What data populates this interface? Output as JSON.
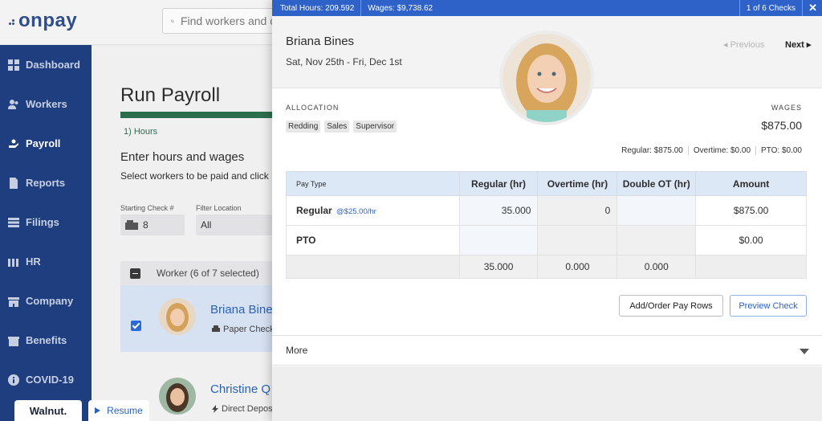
{
  "app": {
    "logo": "onpay"
  },
  "search": {
    "placeholder": "Find workers and co"
  },
  "sidebar": {
    "items": [
      {
        "label": "Dashboard",
        "icon": "dashboard-icon"
      },
      {
        "label": "Workers",
        "icon": "workers-icon"
      },
      {
        "label": "Payroll",
        "icon": "payroll-icon"
      },
      {
        "label": "Reports",
        "icon": "reports-icon"
      },
      {
        "label": "Filings",
        "icon": "filings-icon"
      },
      {
        "label": "HR",
        "icon": "hr-icon"
      },
      {
        "label": "Company",
        "icon": "company-icon"
      },
      {
        "label": "Benefits",
        "icon": "benefits-icon"
      },
      {
        "label": "COVID-19",
        "icon": "info-icon"
      }
    ]
  },
  "payroll_page": {
    "title": "Run Payroll",
    "step": "1) Hours",
    "heading": "Enter hours and wages",
    "subheading": "Select workers to be paid and click",
    "starting_check_label": "Starting Check #",
    "starting_check_value": "8",
    "filter_location_label": "Filter Location",
    "filter_location_value": "All",
    "worker_header": "Worker (6 of 7 selected)",
    "workers": [
      {
        "name": "Briana Bine",
        "method": "Paper Check"
      },
      {
        "name": "Christine Q",
        "method": "Direct Deposit"
      }
    ]
  },
  "walnut": {
    "label": "Walnut."
  },
  "resume": {
    "label": "Resume"
  },
  "panel": {
    "total_hours": "Total Hours: 209.592",
    "total_wages": "Wages: $9,738.62",
    "check_counter": "1 of 6 Checks",
    "close": "✕",
    "employee_name": "Briana Bines",
    "period": "Sat, Nov 25th - Fri, Dec 1st",
    "previous": "◂ Previous",
    "next": "Next ▸",
    "allocation_label": "ALLOCATION",
    "tags": [
      "Redding",
      "Sales",
      "Supervisor"
    ],
    "wages_label": "WAGES",
    "wages_value": "$875.00",
    "summary": {
      "regular": "Regular: $875.00",
      "overtime": "Overtime: $0.00",
      "pto": "PTO: $0.00"
    },
    "table": {
      "headers": [
        "Pay Type",
        "Regular (hr)",
        "Overtime (hr)",
        "Double OT (hr)",
        "Amount"
      ],
      "rows": [
        {
          "type": "Regular",
          "rate": "@$25.00/hr",
          "regular": "35.000",
          "overtime": "0",
          "double_ot": "",
          "amount": "$875.00"
        },
        {
          "type": "PTO",
          "rate": "",
          "regular": "",
          "overtime": "",
          "double_ot": "",
          "amount": "$0.00"
        }
      ],
      "totals": {
        "regular": "35.000",
        "overtime": "0.000",
        "double_ot": "0.000"
      }
    },
    "add_order_button": "Add/Order Pay Rows",
    "preview_button": "Preview Check",
    "more_label": "More"
  }
}
